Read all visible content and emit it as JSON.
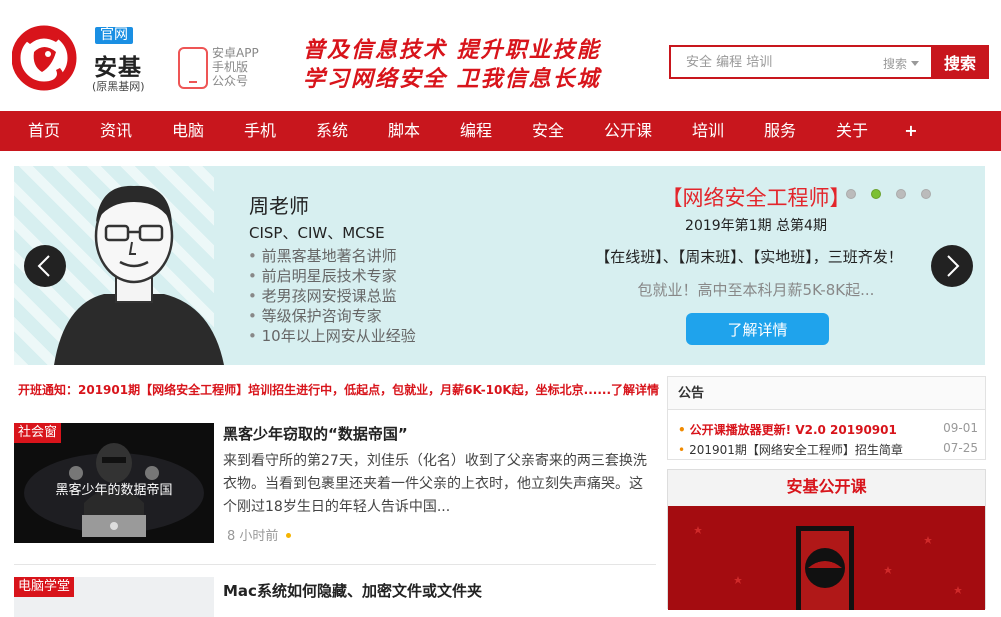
{
  "header": {
    "logo_badge": "官网",
    "logo_name": "安基",
    "logo_sub": "(原黑基网)",
    "app_lines": [
      "安卓APP",
      "手机版",
      "公众号"
    ],
    "slogan_1": "普及信息技术 提升职业技能",
    "slogan_2": "学习网络安全 卫我信息长城"
  },
  "search": {
    "placeholder": "安全 编程 培训",
    "type_label": "搜索",
    "button_label": "搜索"
  },
  "nav": {
    "items": [
      "首页",
      "资讯",
      "电脑",
      "手机",
      "系统",
      "脚本",
      "编程",
      "安全",
      "公开课",
      "培训",
      "服务",
      "关于",
      "+"
    ]
  },
  "banner": {
    "teacher_name": "周老师",
    "teacher_certs": "CISP、CIW、MCSE",
    "teacher_bullets": [
      "前黑客基地著名讲师",
      "前启明星辰技术专家",
      "老男孩网安授课总监",
      "等级保护咨询专家",
      "10年以上网安从业经验"
    ],
    "course_title": "【网络安全工程师】",
    "course_term": "2019年第1期 总第4期",
    "course_classes": "【在线班】、【周末班】、【实地班】，三班齐发！",
    "course_salary": "包就业！高中至本科月薪5K-8K起...",
    "course_button": "了解详情",
    "active_slide": 2,
    "slide_count": 4
  },
  "notice": "开班通知：201901期【网络安全工程师】培训招生进行中，低起点，包就业，月薪6K-10K起，坐标北京......了解详情",
  "articles": [
    {
      "category": "社会窗",
      "thumb_caption": "黑客少年的数据帝国",
      "title": "黑客少年窃取的“数据帝国”",
      "excerpt": "来到看守所的第27天，刘佳乐（化名）收到了父亲寄来的两三套换洗衣物。当看到包裹里还夹着一件父亲的上衣时，他立刻失声痛哭。这个刚过18岁生日的年轻人告诉中国...",
      "time": "8 小时前"
    },
    {
      "category": "电脑学堂",
      "title": "Mac系统如何隐藏、加密文件或文件夹"
    }
  ],
  "announce": {
    "heading": "公告",
    "items": [
      {
        "text": "公开课播放器更新! V2.0 20190901",
        "date": "09-01"
      },
      {
        "text": "201901期【网络安全工程师】招生简章",
        "date": "07-25"
      }
    ]
  },
  "open_course": {
    "heading": "安基公开课"
  },
  "colors": {
    "brand_red": "#c8161d",
    "accent_blue": "#1a8fe3",
    "banner_bg": "#d7eff0"
  }
}
